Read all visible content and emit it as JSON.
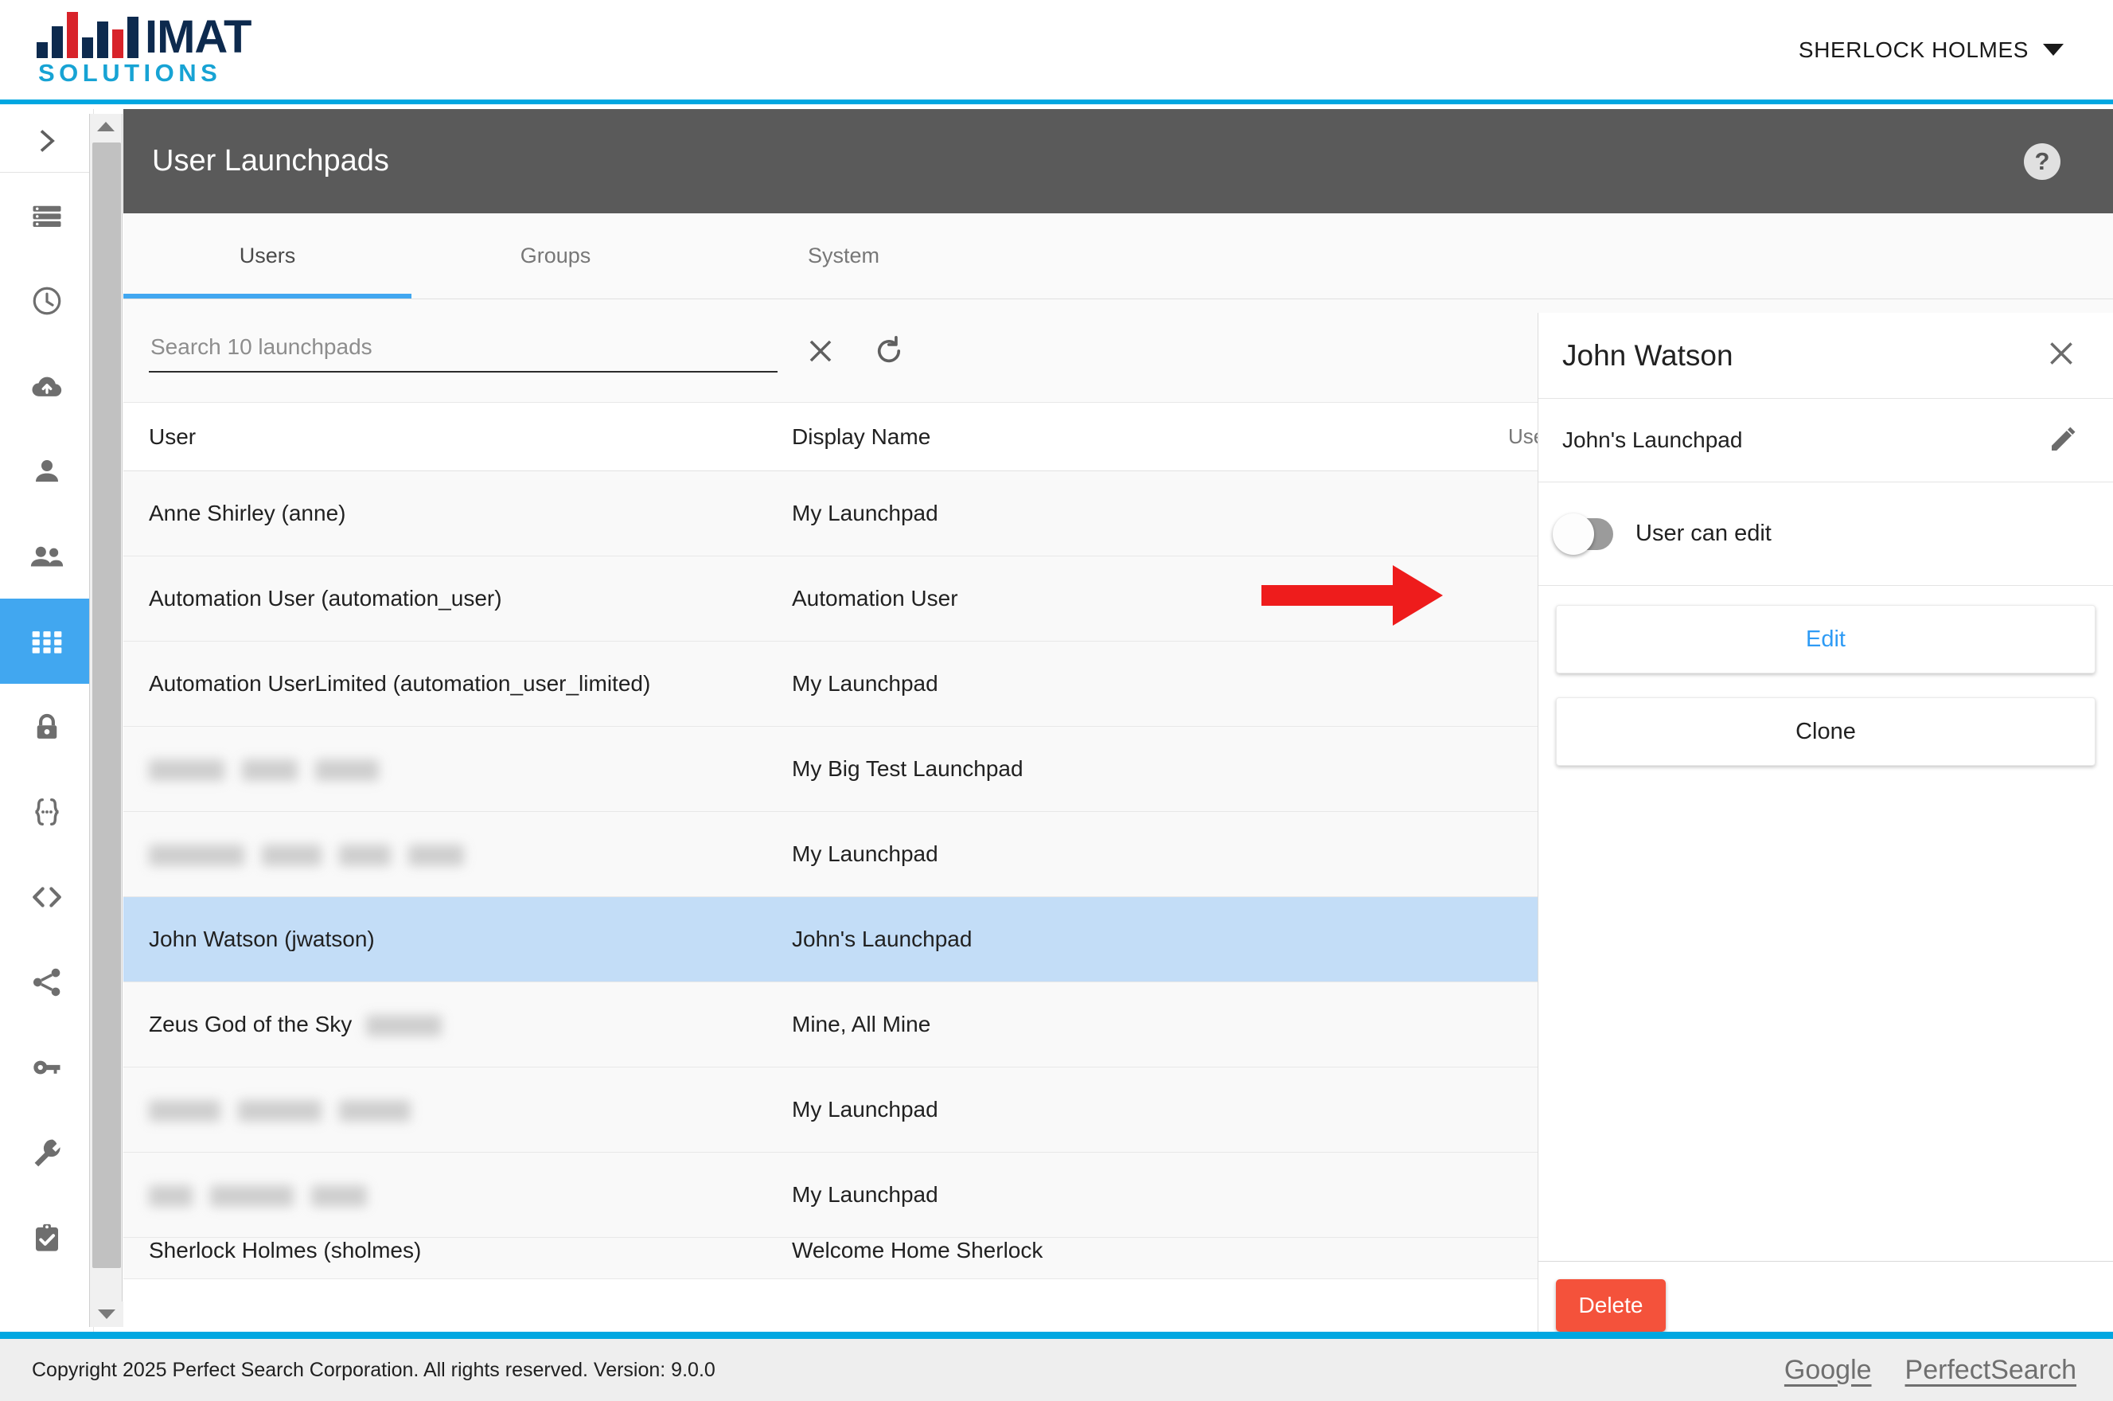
{
  "brand": {
    "name_primary": "IMAT",
    "name_secondary": "SOLUTIONS",
    "color_navy": "#0d2a4e",
    "color_red": "#d8232a",
    "color_cyan": "#17a3d4"
  },
  "topbar": {
    "user_name": "SHERLOCK HOLMES",
    "caret_icon": "chevron-down-icon"
  },
  "rail": {
    "toggle_icon": "chevron-right-icon",
    "items": [
      {
        "icon": "list-icon",
        "active": false
      },
      {
        "icon": "clock-icon",
        "active": false
      },
      {
        "icon": "cloud-upload-icon",
        "active": false
      },
      {
        "icon": "person-icon",
        "active": false
      },
      {
        "icon": "people-icon",
        "active": false
      },
      {
        "icon": "grid-apps-icon",
        "active": true
      },
      {
        "icon": "lock-icon",
        "active": false
      },
      {
        "icon": "braces-icon",
        "active": false
      },
      {
        "icon": "code-icon",
        "active": false
      },
      {
        "icon": "share-icon",
        "active": false
      },
      {
        "icon": "key-icon",
        "active": false
      },
      {
        "icon": "wrench-icon",
        "active": false
      },
      {
        "icon": "clipboard-check-icon",
        "active": false
      }
    ]
  },
  "page": {
    "title": "User Launchpads",
    "help_icon": "question-mark-icon"
  },
  "tabs": [
    {
      "label": "Users",
      "active": true
    },
    {
      "label": "Groups",
      "active": false
    },
    {
      "label": "System",
      "active": false
    }
  ],
  "search": {
    "placeholder": "Search 10 launchpads",
    "value": "",
    "clear_icon": "close-icon",
    "refresh_icon": "refresh-icon"
  },
  "table": {
    "columns": [
      "User",
      "Display Name",
      "User"
    ],
    "rows": [
      {
        "user": "Anne Shirley (anne)",
        "redacted": false,
        "display_name": "My Launchpad",
        "checked": false,
        "selected": false
      },
      {
        "user": "Automation User (automation_user)",
        "redacted": false,
        "display_name": "Automation User",
        "checked": true,
        "selected": false
      },
      {
        "user": "Automation UserLimited (automation_user_limited)",
        "redacted": false,
        "display_name": "My Launchpad",
        "checked": false,
        "selected": false
      },
      {
        "user": "",
        "redacted": true,
        "redact_widths": [
          95,
          70,
          80
        ],
        "display_name": "My Big Test Launchpad",
        "checked": true,
        "selected": false
      },
      {
        "user": "",
        "redacted": true,
        "redact_widths": [
          120,
          75,
          65,
          70
        ],
        "display_name": "My Launchpad",
        "checked": true,
        "selected": false
      },
      {
        "user": "John Watson (jwatson)",
        "redacted": false,
        "display_name": "John's Launchpad",
        "checked": false,
        "selected": true
      },
      {
        "user": "Zeus God of the Sky",
        "redacted": false,
        "trailing_redact": 95,
        "display_name": "Mine, All Mine",
        "checked": true,
        "selected": false
      },
      {
        "user": "",
        "redacted": true,
        "redact_widths": [
          90,
          105,
          90
        ],
        "display_name": "My Launchpad",
        "checked": true,
        "selected": false
      },
      {
        "user": "",
        "redacted": true,
        "redact_widths": [
          55,
          105,
          70
        ],
        "display_name": "My Launchpad",
        "checked": true,
        "selected": false
      },
      {
        "user": "Sherlock Holmes (sholmes)",
        "redacted": false,
        "display_name": "Welcome Home Sherlock",
        "checked": true,
        "selected": false,
        "cut_off": true
      }
    ]
  },
  "detail": {
    "title": "John Watson",
    "close_icon": "close-icon",
    "launchpad_name": "John's Launchpad",
    "edit_pencil_icon": "pencil-icon",
    "toggle_label": "User can edit",
    "toggle_on": false,
    "edit_button": "Edit",
    "clone_button": "Clone",
    "delete_button": "Delete",
    "delete_color": "#f4523b"
  },
  "annotation": {
    "arrow_icon": "red-arrow-right-icon",
    "arrow_color": "#ee1c1c"
  },
  "footer": {
    "copyright": "Copyright 2025 Perfect Search Corporation. All rights reserved. Version: 9.0.0",
    "links": [
      "Google",
      "PerfectSearch"
    ]
  }
}
